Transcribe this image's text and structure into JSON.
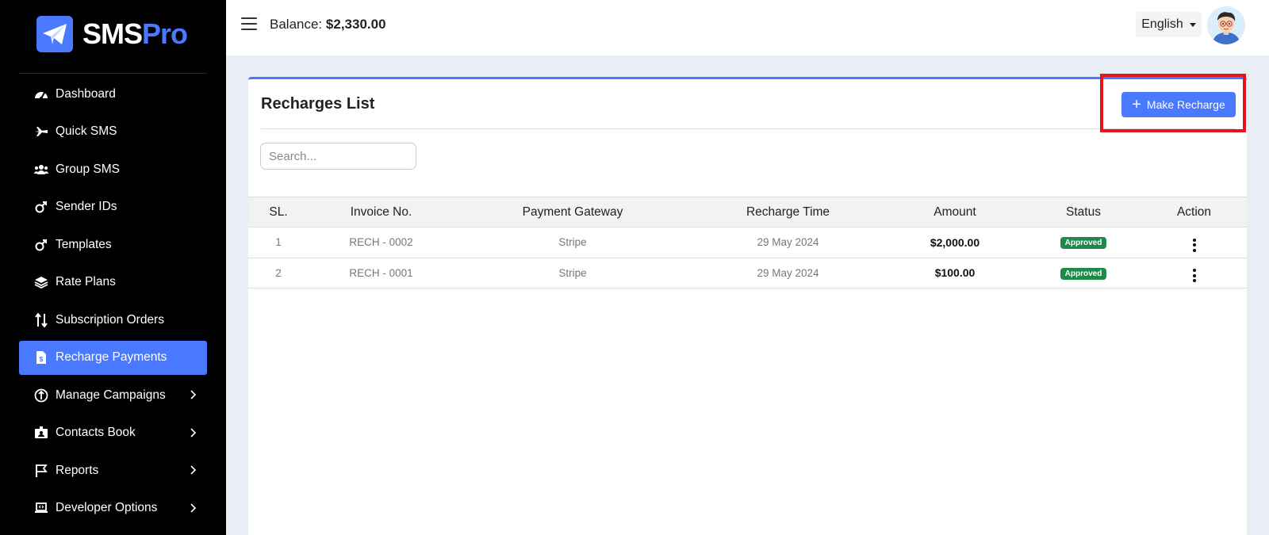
{
  "brand": {
    "sms": "SMS",
    "pro": "Pro",
    "accent": "#4a78ff"
  },
  "sidebar": {
    "items": [
      {
        "label": "Dashboard",
        "icon": "dashboard-gauge-icon"
      },
      {
        "label": "Quick SMS",
        "icon": "plane-icon"
      },
      {
        "label": "Group SMS",
        "icon": "users-icon"
      },
      {
        "label": "Sender IDs",
        "icon": "male-symbol-icon"
      },
      {
        "label": "Templates",
        "icon": "male-symbol-icon"
      },
      {
        "label": "Rate Plans",
        "icon": "layers-icon"
      },
      {
        "label": "Subscription Orders",
        "icon": "sort-arrows-icon"
      },
      {
        "label": "Recharge Payments",
        "icon": "invoice-dollar-icon",
        "active": true
      },
      {
        "label": "Manage Campaigns",
        "icon": "campaign-icon",
        "expandable": true
      },
      {
        "label": "Contacts Book",
        "icon": "id-card-icon",
        "expandable": true
      },
      {
        "label": "Reports",
        "icon": "flag-icon",
        "expandable": true
      },
      {
        "label": "Developer Options",
        "icon": "laptop-code-icon",
        "expandable": true
      }
    ]
  },
  "header": {
    "balance_label": "Balance:",
    "balance_value": "$2,330.00",
    "language": "English"
  },
  "main": {
    "title": "Recharges List",
    "make_recharge_label": "Make Recharge",
    "search_placeholder": "Search...",
    "columns": [
      "SL.",
      "Invoice No.",
      "Payment Gateway",
      "Recharge Time",
      "Amount",
      "Status",
      "Action"
    ],
    "rows": [
      {
        "sl": "1",
        "invoice": "RECH - 0002",
        "gateway": "Stripe",
        "time": "29 May 2024",
        "amount": "$2,000.00",
        "status": "Approved"
      },
      {
        "sl": "2",
        "invoice": "RECH - 0001",
        "gateway": "Stripe",
        "time": "29 May 2024",
        "amount": "$100.00",
        "status": "Approved"
      }
    ]
  },
  "colors": {
    "sidebar_bg": "#000000",
    "accent": "#4a78ff",
    "highlight": "#e4141b",
    "status_approved": "#1d8a4b"
  }
}
